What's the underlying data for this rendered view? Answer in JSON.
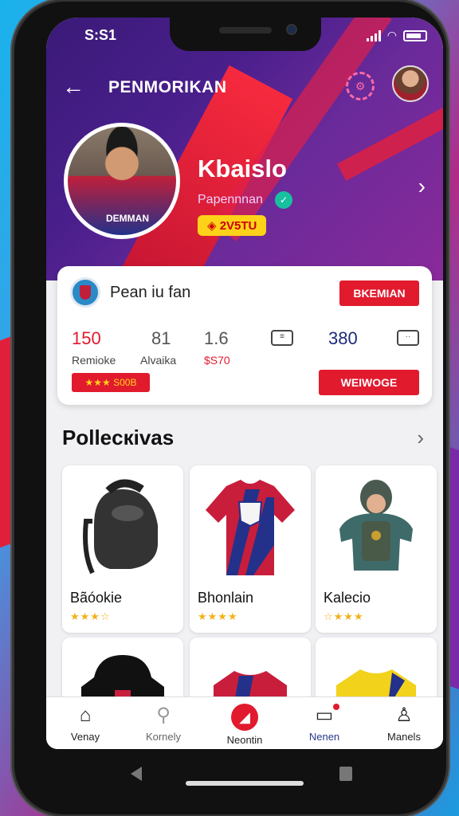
{
  "status": {
    "time": "S:S1"
  },
  "header": {
    "title": "PENMORIKAN",
    "back_icon": "arrow-left-icon",
    "settings_icon": "gear-icon"
  },
  "profile": {
    "name": "Kbaislo",
    "subtitle": "Papennnan",
    "coins": "◈ 2V5TU",
    "jersey": "DEMMAN"
  },
  "card": {
    "title": "Pean iu fan",
    "primary_button": "BKEMIAN",
    "stats": [
      {
        "value": "150",
        "label": "Remioke",
        "color": "#e11a2e"
      },
      {
        "value": "81",
        "label": "Alvaika",
        "color": "#555555"
      },
      {
        "value": "1.6",
        "label": "$S70",
        "color": "#555555",
        "label_color": "#e11a2e"
      },
      {
        "value": "380",
        "label": "",
        "color": "#1c2a7a"
      }
    ],
    "rating": "★★★ S00B",
    "secondary_button": "WEIWOGE"
  },
  "section": {
    "title": "Pollecкivas"
  },
  "products": [
    {
      "name": "Bãóokie",
      "stars": "★★★☆",
      "img": "helmet"
    },
    {
      "name": "Bhonlain",
      "stars": "★★★★",
      "img": "jersey"
    },
    {
      "name": "Kalecio",
      "stars": "☆★★★",
      "img": "figure"
    }
  ],
  "nav": [
    {
      "label": "Venay",
      "icon": "home-icon"
    },
    {
      "label": "Kornely",
      "icon": "search-icon"
    },
    {
      "label": "Neontin",
      "icon": "play-icon"
    },
    {
      "label": "Nenen",
      "icon": "bell-icon"
    },
    {
      "label": "Manels",
      "icon": "user-icon"
    }
  ],
  "colors": {
    "accent": "#e11a2e",
    "hero": "#4a1f8c",
    "coin": "#ffd21a"
  }
}
